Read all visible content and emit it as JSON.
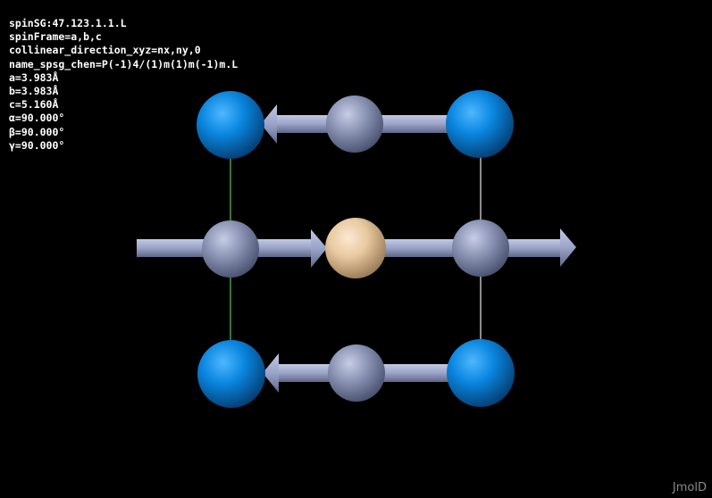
{
  "info_lines": [
    "spinSG:47.123.1.1.L",
    "spinFrame=a,b,c",
    "collinear_direction_xyz=nx,ny,0",
    "name_spsg_chen=P(-1)4/(1)m(1)m(-1)m.L",
    "a=3.983Å",
    "b=3.983Å",
    "c=5.160Å",
    "α=90.000°",
    "β=90.000°",
    "γ=90.000°"
  ],
  "watermark": "JmolD",
  "colors": {
    "background": "#000000",
    "text": "#ffffff",
    "corner_atom": "#0a86e0",
    "magnetic_atom": "#8c95b5",
    "center_atom": "#e9c9a0",
    "spin_arrow": "#9aa3c8",
    "cell_edge": "#bbbbbb",
    "cell_edge_b": "#4a9a4a"
  },
  "atoms": [
    {
      "kind": "corner",
      "id": "top-left"
    },
    {
      "kind": "corner",
      "id": "top-right"
    },
    {
      "kind": "corner",
      "id": "bottom-left"
    },
    {
      "kind": "corner",
      "id": "bottom-right"
    },
    {
      "kind": "magnetic",
      "id": "top-middle",
      "spin": "left"
    },
    {
      "kind": "magnetic",
      "id": "middle-left",
      "spin": "right"
    },
    {
      "kind": "magnetic",
      "id": "middle-right",
      "spin": "right"
    },
    {
      "kind": "magnetic",
      "id": "bottom-middle",
      "spin": "left"
    },
    {
      "kind": "center",
      "id": "body-center"
    }
  ]
}
